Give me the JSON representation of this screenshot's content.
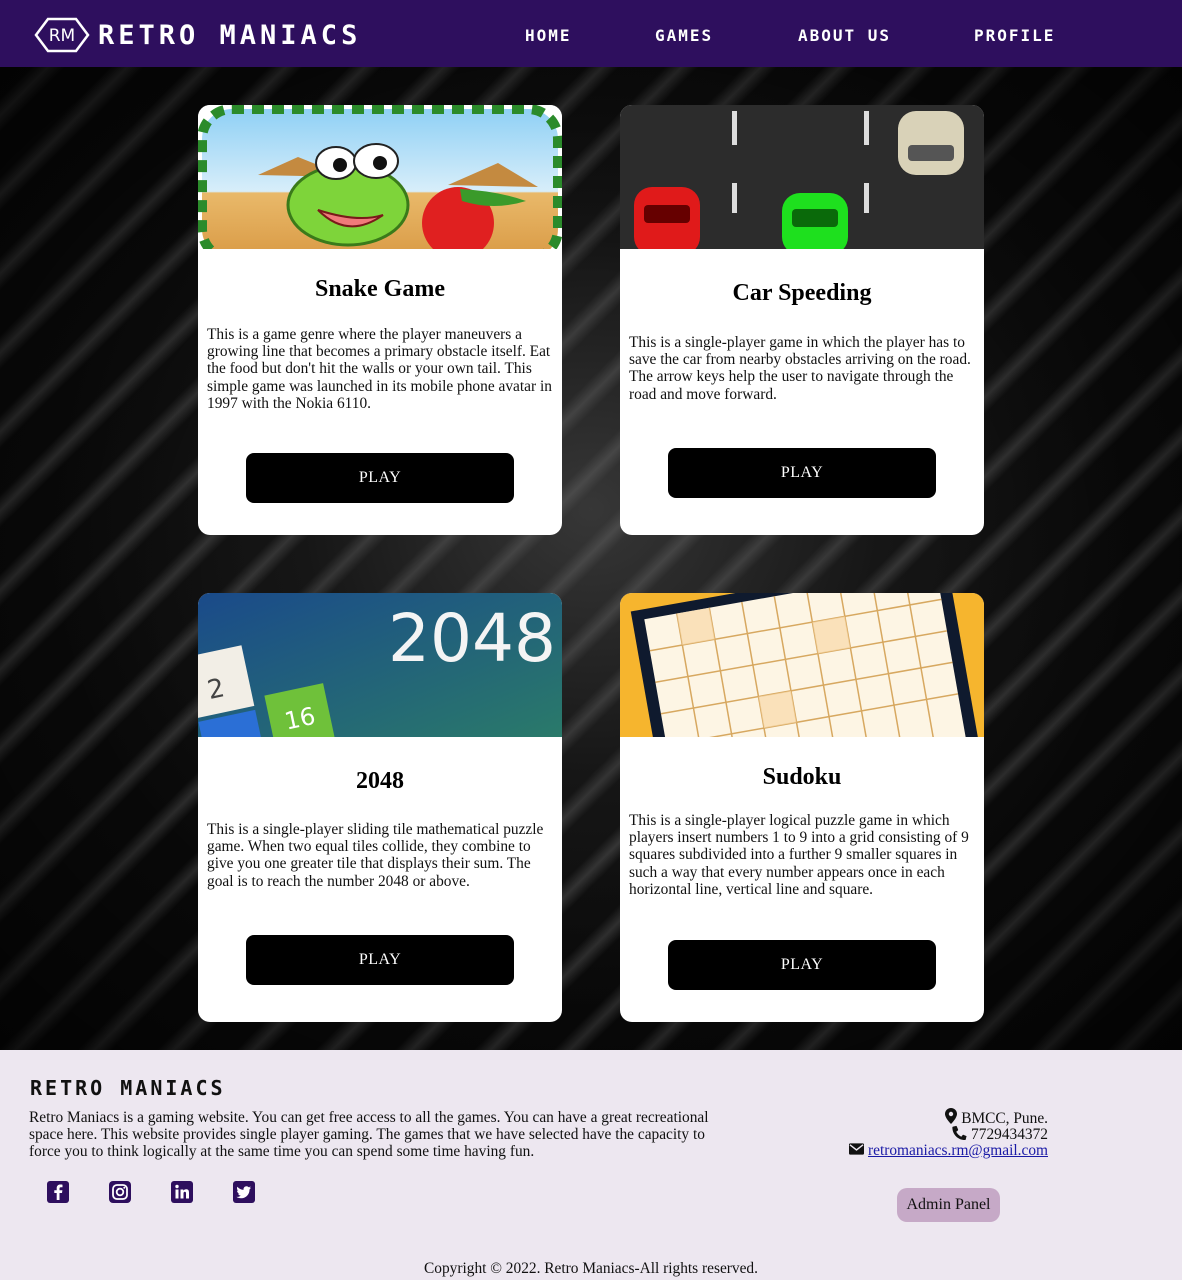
{
  "nav": {
    "logo_initials": "RM",
    "brand": "RETRO MANIACS",
    "links": [
      "HOME",
      "GAMES",
      "ABOUT US",
      "PROFILE"
    ]
  },
  "games": [
    {
      "title": "Snake Game",
      "description": "This is a game genre where the player maneuvers a growing line that becomes a primary obstacle itself. Eat the food but don't hit the walls or your own tail. This simple game was launched in its mobile phone avatar in 1997 with the Nokia 6110.",
      "button": "PLAY"
    },
    {
      "title": "Car Speeding",
      "description": "This is a single-player game in which the player has to save the car from nearby obstacles arriving on the road. The arrow keys help the user to navigate through the road and move forward.",
      "button": "PLAY"
    },
    {
      "title": "2048",
      "thumb_text": "2048",
      "thumb_tiles": [
        "2",
        "16"
      ],
      "description": "This is a single-player sliding tile mathematical puzzle game. When two equal tiles collide, they combine to give you one greater tile that displays their sum. The goal is to reach the number 2048 or above.",
      "button": "PLAY"
    },
    {
      "title": "Sudoku",
      "description": "This is a single-player logical puzzle game in which players insert numbers 1 to 9 into a grid consisting of 9 squares subdivided into a further 9 smaller squares in such a way that every number appears once in each horizontal line, vertical line and square.",
      "button": "PLAY"
    }
  ],
  "footer": {
    "brand": "RETRO MANIACS",
    "description": "Retro Maniacs is a gaming website. You can get free access to all the games. You can have a great recreational space here. This website provides single player gaming. The games that we have selected have the capacity to force you to think logically at the same time you can spend some time having fun.",
    "social_icons": [
      "facebook-icon",
      "instagram-icon",
      "linkedin-icon",
      "twitter-icon"
    ],
    "address": "BMCC, Pune.",
    "phone": "7729434372",
    "email": "retromaniacs.rm@gmail.com",
    "admin_label": "Admin Panel",
    "copyright": "Copyright © 2022. Retro Maniacs-All rights reserved."
  },
  "colors": {
    "nav_bg": "#2e0f5e",
    "footer_bg": "#ede7f0",
    "admin_bg": "#c6a9c7",
    "icon_color": "#2e0f5e"
  }
}
